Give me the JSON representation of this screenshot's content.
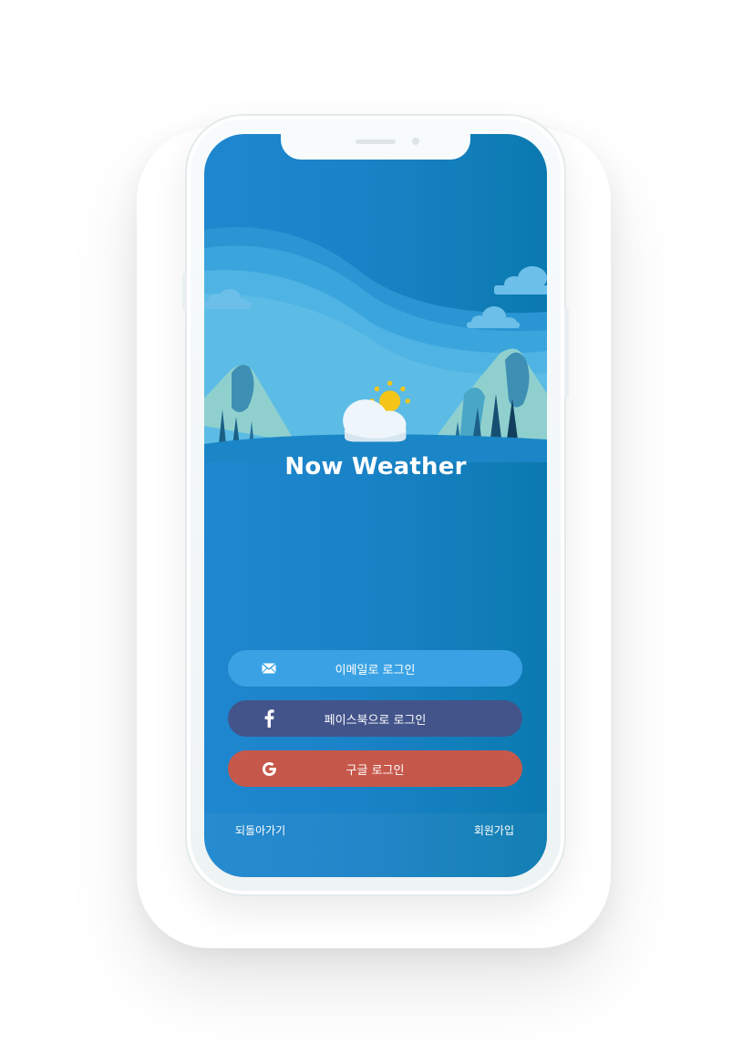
{
  "app": {
    "title": "Now Weather"
  },
  "login": {
    "email_label": "이메일로 로그인",
    "facebook_label": "페이스북으로 로그인",
    "google_label": "구글 로그인"
  },
  "footer": {
    "back_label": "되돌아가기",
    "signup_label": "회원가입"
  },
  "icons": {
    "email": "envelope-icon",
    "facebook": "facebook-icon",
    "google": "google-icon",
    "logo": "sun-cloud-icon"
  },
  "colors": {
    "screen_bg": "#1f87cf",
    "email_button": "#3aa2e4",
    "facebook_button": "#43548b",
    "google_button": "#c6584b",
    "sun": "#f5c518"
  }
}
